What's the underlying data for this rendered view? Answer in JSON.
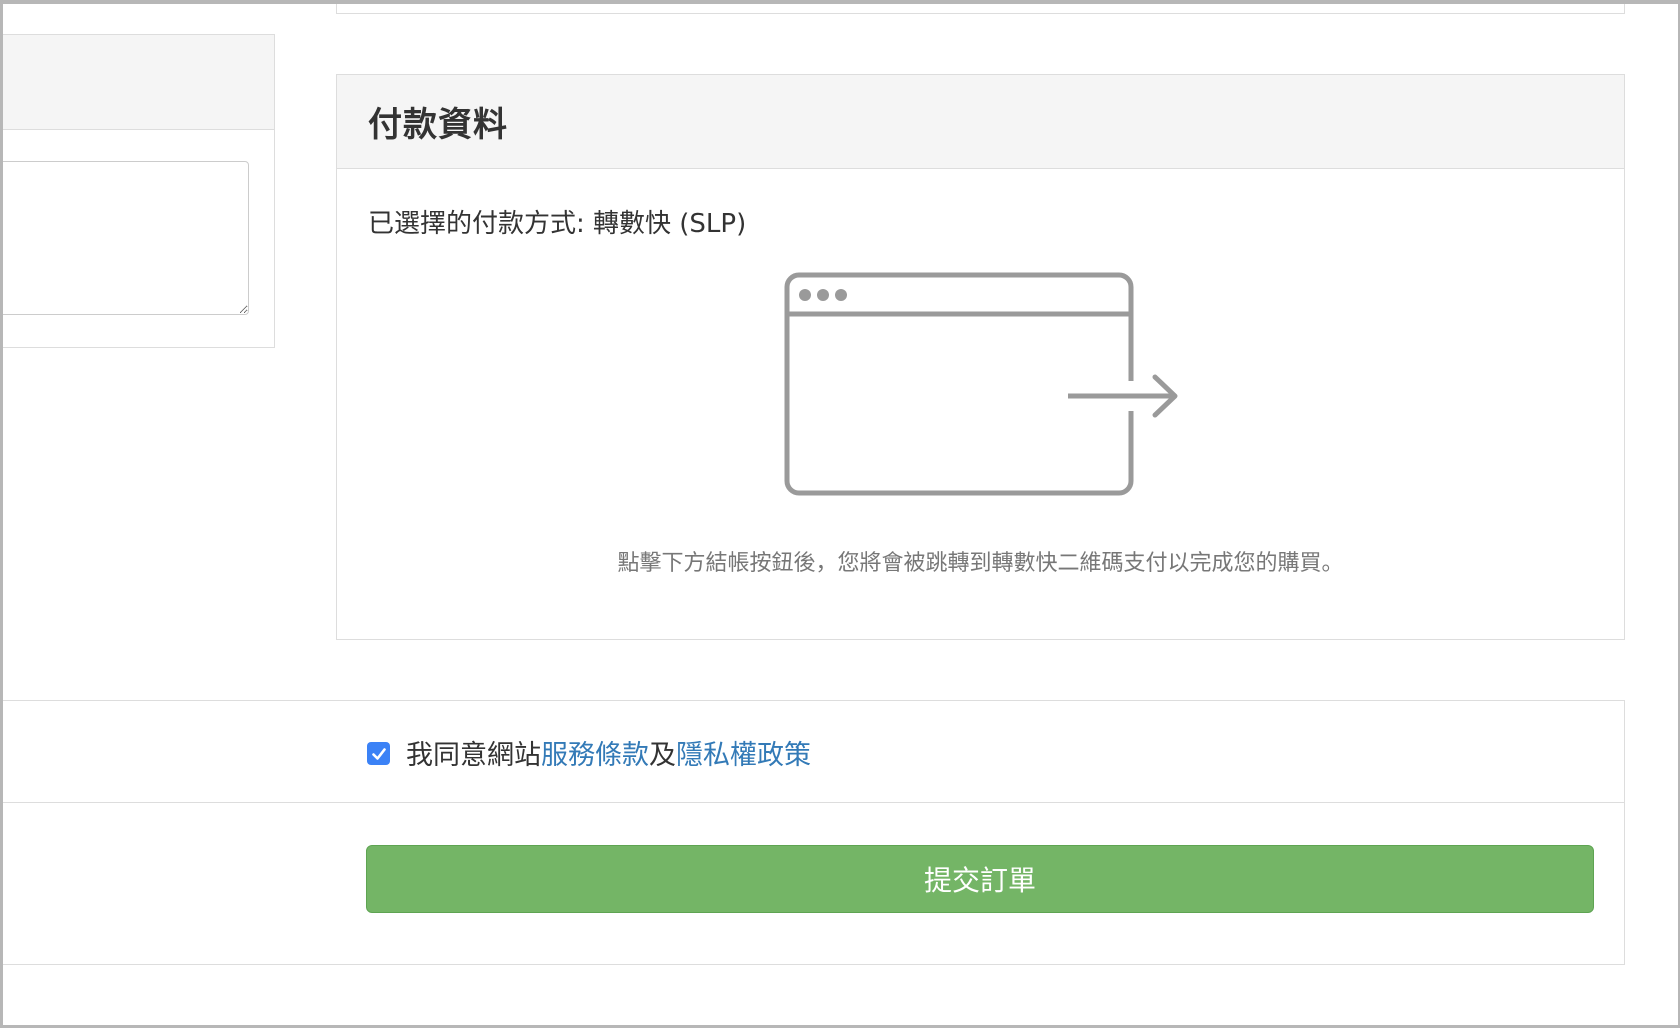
{
  "payment": {
    "title": "付款資料",
    "selected_method": "已選擇的付款方式: 轉數快 (SLP)",
    "redirect_note": "點擊下方結帳按鈕後，您將會被跳轉到轉數快二維碼支付以完成您的購買。"
  },
  "agreement": {
    "checked": true,
    "prefix": "我同意網站",
    "terms_link": "服務條款",
    "conjunction": "及",
    "privacy_link": "隱私權政策"
  },
  "submit": {
    "label": "提交訂單"
  },
  "colors": {
    "accent_link": "#337ab7",
    "checkbox": "#3b82f6",
    "submit_button": "#74b566",
    "panel_heading_bg": "#f5f5f5",
    "border": "#dddddd"
  },
  "icons": {
    "redirect": "browser-window-redirect-icon",
    "checkbox": "checkmark-icon"
  }
}
